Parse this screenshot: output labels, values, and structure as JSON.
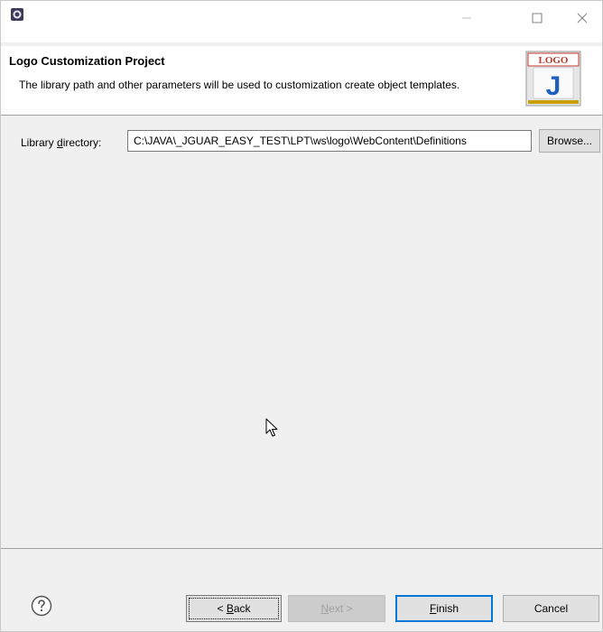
{
  "dialog": {
    "title": "Logo Customization Project",
    "description": "The library path and other parameters will be used to customization create object templates.",
    "logo_text": "LOGO",
    "logo_letter": "J"
  },
  "window_controls": {
    "icons": [
      "minimize-icon",
      "maximize-icon",
      "close-icon"
    ]
  },
  "form": {
    "library_label_prefix": "Library ",
    "library_label_mnemonic": "d",
    "library_label_suffix": "irectory:",
    "library_value": "C:\\JAVA\\_JGUAR_EASY_TEST\\LPT\\ws\\logo\\WebContent\\Definitions",
    "browse_label": "Browse..."
  },
  "footer": {
    "back_prefix": "< ",
    "back_mnemonic": "B",
    "back_suffix": "ack",
    "next_mnemonic": "N",
    "next_suffix": "ext >",
    "finish_mnemonic": "F",
    "finish_suffix": "inish",
    "cancel_label": "Cancel"
  },
  "colors": {
    "accent": "#0078d7",
    "logo_red": "#c0392b",
    "logo_blue": "#1f5fbf"
  }
}
